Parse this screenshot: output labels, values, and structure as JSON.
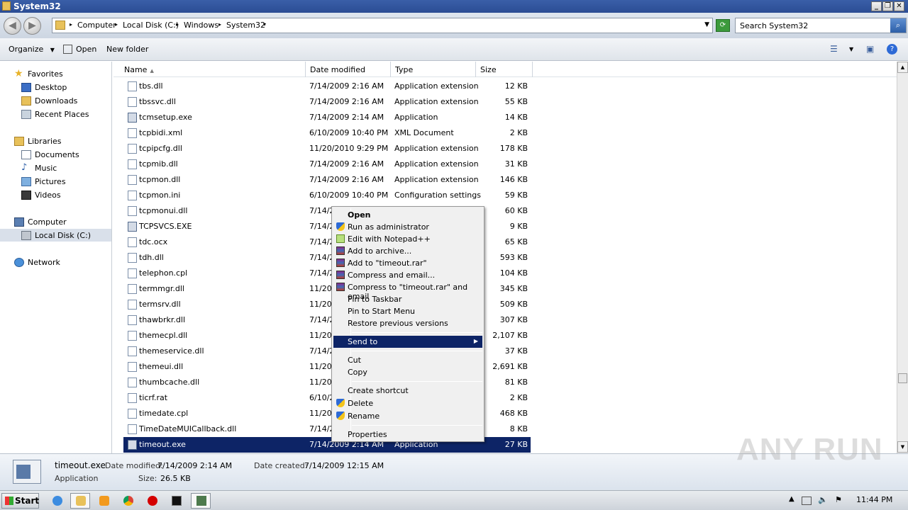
{
  "window": {
    "title": "System32"
  },
  "address": {
    "crumbs": [
      "Computer",
      "Local Disk (C:)",
      "Windows",
      "System32"
    ],
    "search_placeholder": "Search System32"
  },
  "toolbar": {
    "organize": "Organize",
    "open": "Open",
    "new_folder": "New folder"
  },
  "nav": {
    "favorites": "Favorites",
    "desktop": "Desktop",
    "downloads": "Downloads",
    "recent": "Recent Places",
    "libraries": "Libraries",
    "documents": "Documents",
    "music": "Music",
    "pictures": "Pictures",
    "videos": "Videos",
    "computer": "Computer",
    "local_disk": "Local Disk (C:)",
    "network": "Network"
  },
  "columns": {
    "name": "Name",
    "date": "Date modified",
    "type": "Type",
    "size": "Size"
  },
  "files": [
    {
      "name": "tbs.dll",
      "date": "7/14/2009 2:16 AM",
      "type": "Application extension",
      "size": "12 KB"
    },
    {
      "name": "tbssvc.dll",
      "date": "7/14/2009 2:16 AM",
      "type": "Application extension",
      "size": "55 KB"
    },
    {
      "name": "tcmsetup.exe",
      "date": "7/14/2009 2:14 AM",
      "type": "Application",
      "size": "14 KB"
    },
    {
      "name": "tcpbidi.xml",
      "date": "6/10/2009 10:40 PM",
      "type": "XML Document",
      "size": "2 KB"
    },
    {
      "name": "tcpipcfg.dll",
      "date": "11/20/2010 9:29 PM",
      "type": "Application extension",
      "size": "178 KB"
    },
    {
      "name": "tcpmib.dll",
      "date": "7/14/2009 2:16 AM",
      "type": "Application extension",
      "size": "31 KB"
    },
    {
      "name": "tcpmon.dll",
      "date": "7/14/2009 2:16 AM",
      "type": "Application extension",
      "size": "146 KB"
    },
    {
      "name": "tcpmon.ini",
      "date": "6/10/2009 10:40 PM",
      "type": "Configuration settings",
      "size": "59 KB"
    },
    {
      "name": "tcpmonui.dll",
      "date": "7/14/2",
      "type": "",
      "size": "60 KB"
    },
    {
      "name": "TCPSVCS.EXE",
      "date": "7/14/2",
      "type": "",
      "size": "9 KB"
    },
    {
      "name": "tdc.ocx",
      "date": "7/14/2",
      "type": "",
      "size": "65 KB"
    },
    {
      "name": "tdh.dll",
      "date": "7/14/2",
      "type": "",
      "size": "593 KB"
    },
    {
      "name": "telephon.cpl",
      "date": "7/14/2",
      "type": "",
      "size": "104 KB"
    },
    {
      "name": "termmgr.dll",
      "date": "11/20/",
      "type": "",
      "size": "345 KB"
    },
    {
      "name": "termsrv.dll",
      "date": "11/20/",
      "type": "",
      "size": "509 KB"
    },
    {
      "name": "thawbrkr.dll",
      "date": "7/14/2",
      "type": "",
      "size": "307 KB"
    },
    {
      "name": "themecpl.dll",
      "date": "11/20/",
      "type": "",
      "size": "2,107 KB"
    },
    {
      "name": "themeservice.dll",
      "date": "7/14/2",
      "type": "",
      "size": "37 KB"
    },
    {
      "name": "themeui.dll",
      "date": "11/20/",
      "type": "",
      "size": "2,691 KB"
    },
    {
      "name": "thumbcache.dll",
      "date": "11/20/",
      "type": "",
      "size": "81 KB"
    },
    {
      "name": "ticrf.rat",
      "date": "6/10/2",
      "type": "",
      "size": "2 KB"
    },
    {
      "name": "timedate.cpl",
      "date": "11/20/",
      "type": "",
      "size": "468 KB"
    },
    {
      "name": "TimeDateMUICallback.dll",
      "date": "7/14/2",
      "type": "",
      "size": "8 KB"
    },
    {
      "name": "timeout.exe",
      "date": "7/14/2009 2:14 AM",
      "type": "Application",
      "size": "27 KB"
    }
  ],
  "context_menu": {
    "open": "Open",
    "run_admin": "Run as administrator",
    "edit_npp": "Edit with Notepad++",
    "add_archive": "Add to archive...",
    "add_rar": "Add to \"timeout.rar\"",
    "compress_email": "Compress and email...",
    "compress_rar_email": "Compress to \"timeout.rar\" and email",
    "pin_taskbar": "Pin to Taskbar",
    "pin_start": "Pin to Start Menu",
    "restore": "Restore previous versions",
    "send_to": "Send to",
    "cut": "Cut",
    "copy": "Copy",
    "create_shortcut": "Create shortcut",
    "delete": "Delete",
    "rename": "Rename",
    "properties": "Properties"
  },
  "details": {
    "name": "timeout.exe",
    "kind": "Application",
    "date_modified_label": "Date modified:",
    "date_modified": "7/14/2009 2:14 AM",
    "date_created_label": "Date created:",
    "date_created": "7/14/2009 12:15 AM",
    "size_label": "Size:",
    "size": "26.5 KB"
  },
  "watermark": "ANY RUN",
  "taskbar": {
    "start": "Start",
    "clock": "11:44 PM"
  },
  "colors": {
    "selection": "#0d2466",
    "titlebar": "#2b4d94"
  }
}
